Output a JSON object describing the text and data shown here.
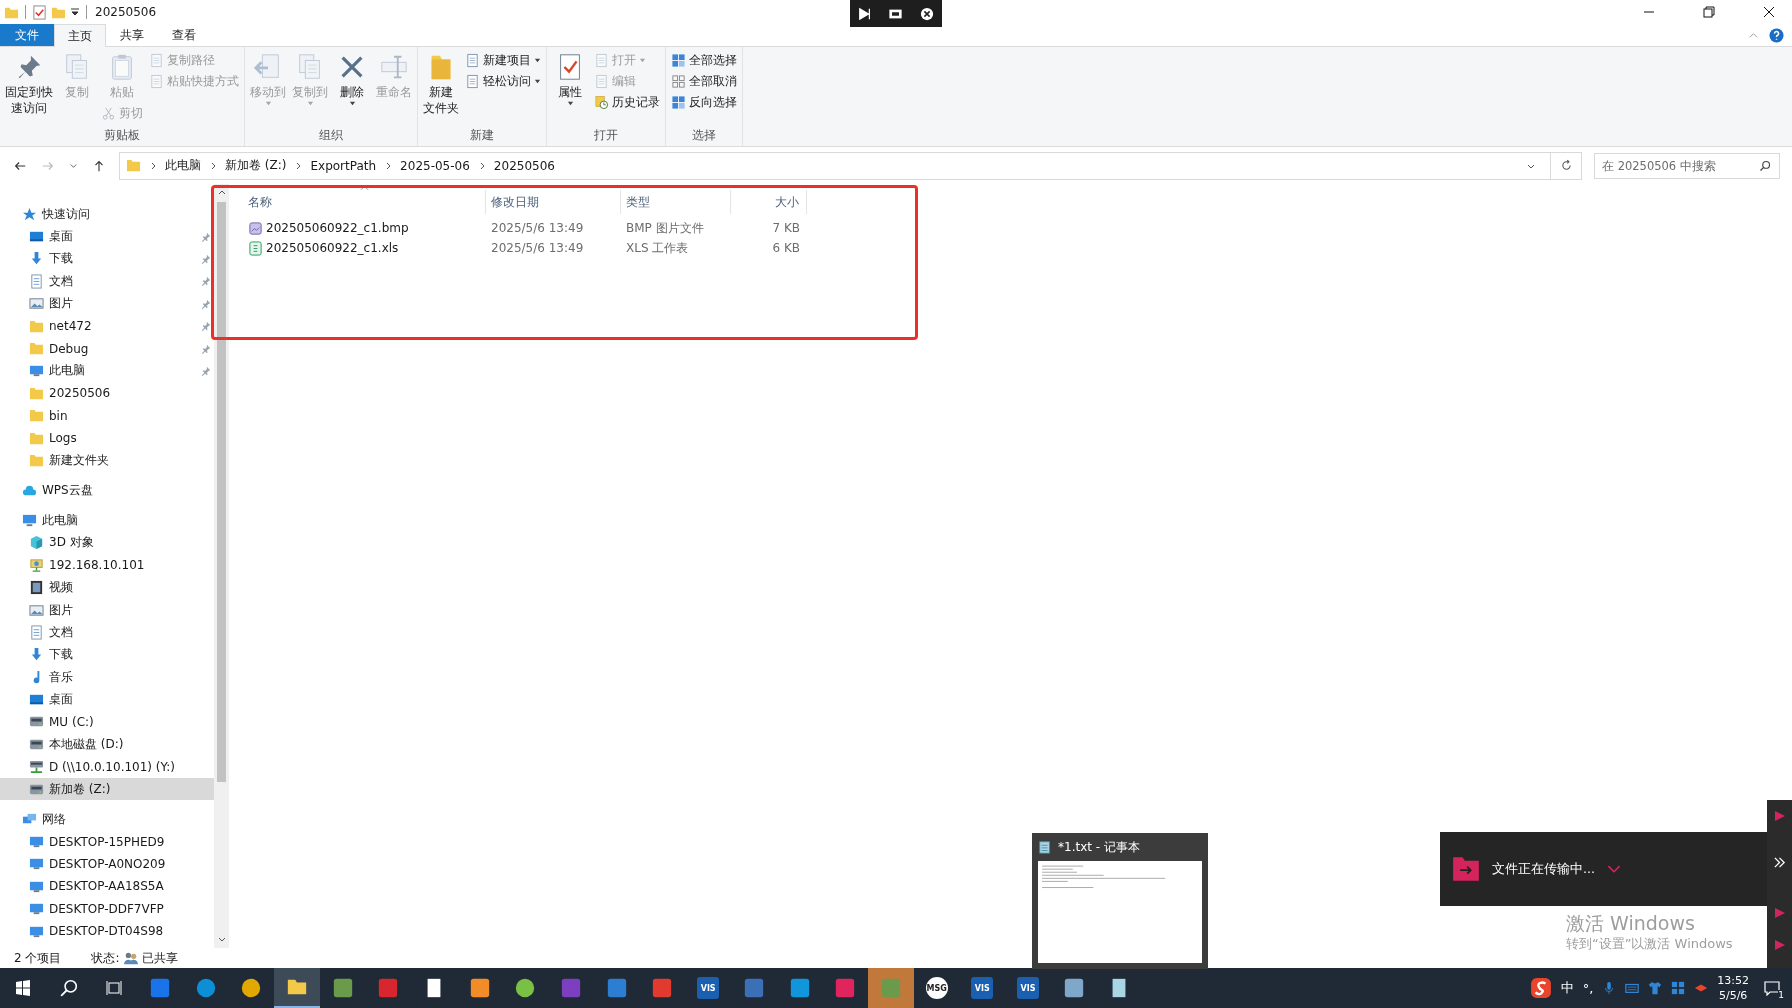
{
  "window": {
    "title": "20250506"
  },
  "ribbon_tabs": [
    {
      "label": "文件",
      "kind": "file",
      "selected": false
    },
    {
      "label": "主页",
      "kind": "tab",
      "selected": true
    },
    {
      "label": "共享",
      "kind": "tab",
      "selected": false
    },
    {
      "label": "查看",
      "kind": "tab",
      "selected": false
    }
  ],
  "ribbon": {
    "groups": [
      {
        "label": "剪贴板",
        "columns": [
          [
            {
              "kind": "large",
              "lines": [
                "固定到快",
                "速访问"
              ],
              "disabled": false,
              "dropdown": false
            }
          ],
          [
            {
              "kind": "large",
              "lines": [
                "复制"
              ],
              "disabled": true,
              "dropdown": false
            }
          ],
          [
            {
              "kind": "large",
              "lines": [
                "粘贴"
              ],
              "disabled": true,
              "dropdown": false
            },
            {
              "kind": "small",
              "lines": [
                "剪切"
              ],
              "disabled": true,
              "dropdown": false
            }
          ],
          [
            {
              "kind": "small",
              "lines": [
                "复制路径"
              ],
              "disabled": true,
              "dropdown": false
            },
            {
              "kind": "small",
              "lines": [
                "粘贴快捷方式"
              ],
              "disabled": true,
              "dropdown": false
            }
          ]
        ]
      },
      {
        "label": "组织",
        "columns": [
          [
            {
              "kind": "large",
              "lines": [
                "移动到"
              ],
              "disabled": true,
              "dropdown": true
            }
          ],
          [
            {
              "kind": "large",
              "lines": [
                "复制到"
              ],
              "disabled": true,
              "dropdown": true
            }
          ],
          [
            {
              "kind": "large",
              "lines": [
                "删除"
              ],
              "disabled": false,
              "dropdown": true
            }
          ],
          [
            {
              "kind": "large",
              "lines": [
                "重命名"
              ],
              "disabled": true,
              "dropdown": false
            }
          ]
        ]
      },
      {
        "label": "新建",
        "columns": [
          [
            {
              "kind": "large",
              "lines": [
                "新建",
                "文件夹"
              ],
              "disabled": false,
              "dropdown": false
            }
          ],
          [
            {
              "kind": "small",
              "lines": [
                "新建项目"
              ],
              "disabled": false,
              "dropdown": true
            },
            {
              "kind": "small",
              "lines": [
                "轻松访问"
              ],
              "disabled": false,
              "dropdown": true
            }
          ]
        ]
      },
      {
        "label": "打开",
        "columns": [
          [
            {
              "kind": "large",
              "lines": [
                "属性"
              ],
              "disabled": false,
              "dropdown": true
            }
          ],
          [
            {
              "kind": "small",
              "lines": [
                "打开"
              ],
              "disabled": true,
              "dropdown": true
            },
            {
              "kind": "small",
              "lines": [
                "编辑"
              ],
              "disabled": true,
              "dropdown": false
            },
            {
              "kind": "small",
              "lines": [
                "历史记录"
              ],
              "disabled": false,
              "dropdown": false
            }
          ]
        ]
      },
      {
        "label": "选择",
        "columns": [
          [
            {
              "kind": "small",
              "lines": [
                "全部选择"
              ],
              "disabled": false,
              "dropdown": false
            },
            {
              "kind": "small",
              "lines": [
                "全部取消"
              ],
              "disabled": false,
              "dropdown": false
            },
            {
              "kind": "small",
              "lines": [
                "反向选择"
              ],
              "disabled": false,
              "dropdown": false
            }
          ]
        ]
      }
    ]
  },
  "address": {
    "crumbs": [
      "此电脑",
      "新加卷 (Z:)",
      "ExportPath",
      "2025-05-06",
      "20250506"
    ],
    "search": {
      "placeholder": "在 20250506 中搜索"
    }
  },
  "sidebar": {
    "sections": [
      {
        "label": "快速访问",
        "kind": "star",
        "selected": false,
        "children": [
          {
            "label": "桌面",
            "kind": "desktop",
            "pinned": true,
            "selected": false
          },
          {
            "label": "下载",
            "kind": "download",
            "pinned": true,
            "selected": false
          },
          {
            "label": "文档",
            "kind": "doc",
            "pinned": true,
            "selected": false
          },
          {
            "label": "图片",
            "kind": "picture",
            "pinned": true,
            "selected": false
          },
          {
            "label": "net472",
            "kind": "folder",
            "pinned": true,
            "selected": false
          },
          {
            "label": "Debug",
            "kind": "folder",
            "pinned": true,
            "selected": false
          },
          {
            "label": "此电脑",
            "kind": "pc",
            "pinned": true,
            "selected": false
          },
          {
            "label": "20250506",
            "kind": "folder",
            "pinned": false,
            "selected": false
          },
          {
            "label": "bin",
            "kind": "folder",
            "pinned": false,
            "selected": false
          },
          {
            "label": "Logs",
            "kind": "folder",
            "pinned": false,
            "selected": false
          },
          {
            "label": "新建文件夹",
            "kind": "folder",
            "pinned": false,
            "selected": false
          }
        ]
      },
      {
        "label": "WPS云盘",
        "kind": "cloud",
        "selected": false
      },
      {
        "label": "此电脑",
        "kind": "pc",
        "selected": false,
        "children": [
          {
            "label": "3D 对象",
            "kind": "cube",
            "pinned": false,
            "selected": false
          },
          {
            "label": "192.168.10.101",
            "kind": "netpc",
            "pinned": false,
            "selected": false
          },
          {
            "label": "视频",
            "kind": "video",
            "pinned": false,
            "selected": false
          },
          {
            "label": "图片",
            "kind": "picture",
            "pinned": false,
            "selected": false
          },
          {
            "label": "文档",
            "kind": "doc",
            "pinned": false,
            "selected": false
          },
          {
            "label": "下载",
            "kind": "download",
            "pinned": false,
            "selected": false
          },
          {
            "label": "音乐",
            "kind": "music",
            "pinned": false,
            "selected": false
          },
          {
            "label": "桌面",
            "kind": "desktop",
            "pinned": false,
            "selected": false
          },
          {
            "label": "MU (C:)",
            "kind": "drive",
            "pinned": false,
            "selected": false
          },
          {
            "label": "本地磁盘 (D:)",
            "kind": "drive",
            "pinned": false,
            "selected": false
          },
          {
            "label": "D (\\\\10.0.10.101) (Y:)",
            "kind": "netdrive",
            "pinned": false,
            "selected": false
          },
          {
            "label": "新加卷 (Z:)",
            "kind": "drive",
            "pinned": false,
            "selected": true
          }
        ]
      },
      {
        "label": "网络",
        "kind": "network",
        "selected": false,
        "children": [
          {
            "label": "DESKTOP-15PHED9",
            "kind": "pc",
            "pinned": false,
            "selected": false
          },
          {
            "label": "DESKTOP-A0NO209",
            "kind": "pc",
            "pinned": false,
            "selected": false
          },
          {
            "label": "DESKTOP-AA18S5A",
            "kind": "pc",
            "pinned": false,
            "selected": false
          },
          {
            "label": "DESKTOP-DDF7VFP",
            "kind": "pc",
            "pinned": false,
            "selected": false
          },
          {
            "label": "DESKTOP-DT04S98",
            "kind": "pc",
            "pinned": false,
            "selected": false
          }
        ]
      }
    ]
  },
  "file_list": {
    "columns": [
      "名称",
      "修改日期",
      "类型",
      "大小"
    ],
    "rows": [
      {
        "kind": "bmp",
        "name": "202505060922_c1.bmp",
        "date": "2025/5/6 13:49",
        "type": "BMP 图片文件",
        "size": "7 KB"
      },
      {
        "kind": "xls",
        "name": "202505060922_c1.xls",
        "date": "2025/5/6 13:49",
        "type": "XLS 工作表",
        "size": "6 KB"
      }
    ]
  },
  "status_bar": {
    "count": "2 个项目",
    "state_label": "状态:",
    "state": "已共享"
  },
  "notepad_preview": {
    "title": "*1.txt - 记事本"
  },
  "toast": {
    "message": "文件正在传输中..."
  },
  "watermarks": [
    {
      "title": "激活 Windows",
      "hint": "转到“设置”以激活 Windows"
    }
  ],
  "taskbar": {
    "apps": [
      {
        "kind": "arrow-tile",
        "selected": false,
        "attention": false
      },
      {
        "kind": "globe",
        "selected": false,
        "attention": false
      },
      {
        "kind": "ring",
        "selected": false,
        "attention": false
      },
      {
        "kind": "folder",
        "selected": true,
        "attention": false
      },
      {
        "kind": "box",
        "selected": false,
        "attention": false
      },
      {
        "kind": "red-tile",
        "selected": false,
        "attention": false
      },
      {
        "kind": "page",
        "selected": false,
        "attention": false
      },
      {
        "kind": "color-grid",
        "selected": false,
        "attention": false
      },
      {
        "kind": "leaf",
        "selected": false,
        "attention": false
      },
      {
        "kind": "purple-tile",
        "selected": false,
        "attention": false
      },
      {
        "kind": "blue-window",
        "selected": false,
        "attention": false
      },
      {
        "kind": "red-mark",
        "selected": false,
        "attention": false
      },
      {
        "kind": "text-tile",
        "label": "VIS",
        "selected": false,
        "attention": false
      },
      {
        "kind": "monitor",
        "selected": false,
        "attention": false
      },
      {
        "kind": "chat-tile",
        "selected": false,
        "attention": false
      },
      {
        "kind": "pink-tile",
        "selected": false,
        "attention": false
      },
      {
        "kind": "box",
        "selected": false,
        "attention": true
      },
      {
        "kind": "text-circle",
        "label": "MSG",
        "selected": false,
        "attention": false
      },
      {
        "kind": "text-tile",
        "label": "VIS",
        "selected": false,
        "attention": false
      },
      {
        "kind": "text-tile",
        "label": "VIS",
        "selected": false,
        "attention": false
      },
      {
        "kind": "bird",
        "selected": false,
        "attention": false
      },
      {
        "kind": "notepad",
        "selected": false,
        "attention": false
      }
    ],
    "ime_mode": "中",
    "punctuation": "°,",
    "time": "13:52",
    "date": "5/5/6",
    "notification_count": "1"
  }
}
